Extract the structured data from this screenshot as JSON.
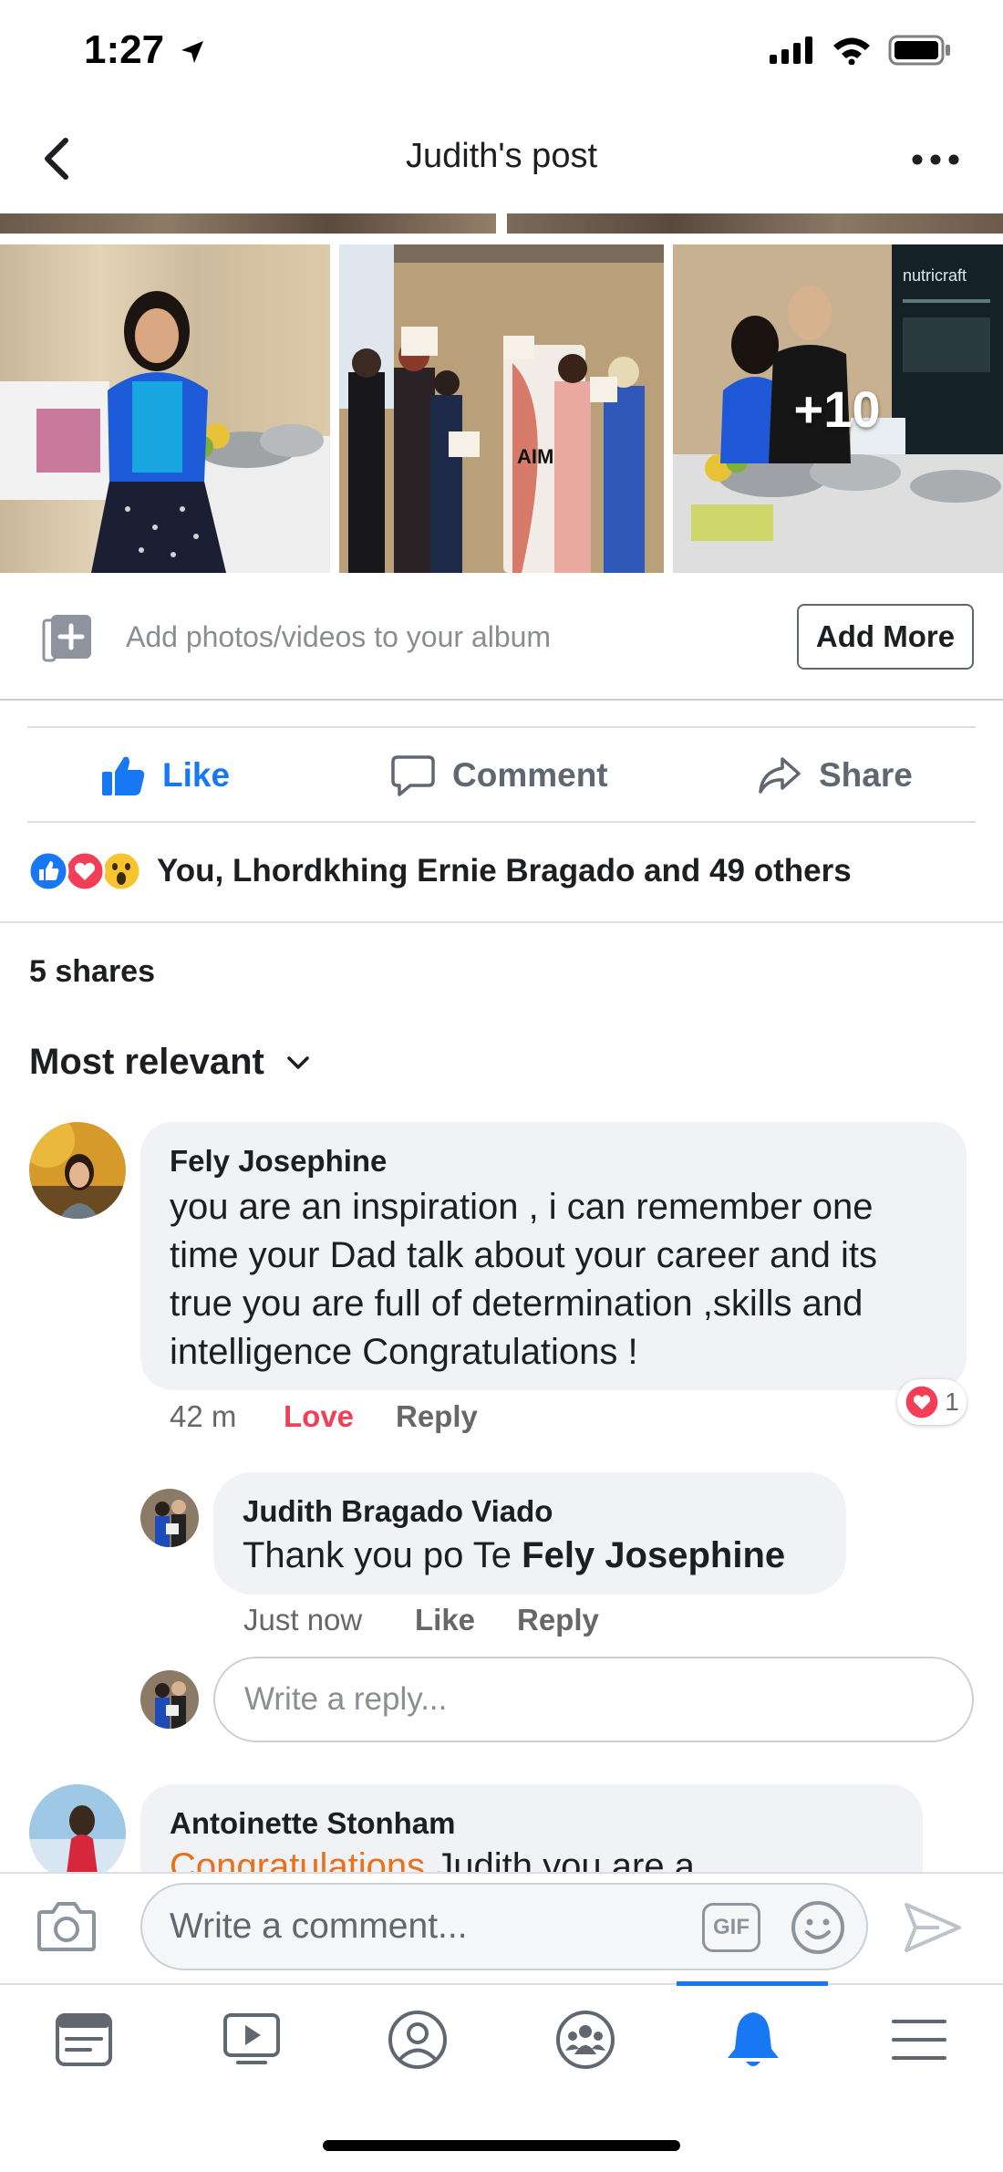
{
  "status_bar": {
    "time": "1:27"
  },
  "header": {
    "title": "Judith's post"
  },
  "photos": {
    "more_count": "+10",
    "booth_banner": "nutricraft",
    "pull_banner": "AIMM"
  },
  "album": {
    "placeholder": "Add photos/videos to your album",
    "add_more_label": "Add More"
  },
  "actions": {
    "like": "Like",
    "comment": "Comment",
    "share": "Share"
  },
  "reactions": {
    "summary": "You, Lhordkhing Ernie Bragado and 49 others"
  },
  "shares": "5 shares",
  "sort": {
    "label": "Most relevant"
  },
  "comments": [
    {
      "author": "Fely Josephine",
      "lines": [
        "you are an inspiration , i can remember one",
        "time your Dad talk about your career and its",
        "true you are full of determination ,skills  and",
        "intelligence Congratulations !"
      ],
      "time": "42 m",
      "reaction_label": "Love",
      "reply_label": "Reply",
      "reaction_count": "1"
    }
  ],
  "reply": {
    "author": "Judith Bragado Viado",
    "text_prefix": "Thank you po Te ",
    "mention": "Fely Josephine",
    "time": "Just now",
    "like_label": "Like",
    "reply_label": "Reply"
  },
  "reply_input": {
    "placeholder": "Write a reply..."
  },
  "next_comment": {
    "author": "Antoinette Stonham",
    "highlight": "Congratulations",
    "text": " Judith you are a"
  },
  "composer": {
    "placeholder": "Write a comment...",
    "gif_label": "GIF"
  },
  "colors": {
    "brand_blue": "#1877f2",
    "love_red": "#f33e58",
    "text_primary": "#1c1e21",
    "text_secondary": "#65676b",
    "bubble_bg": "#f0f2f5",
    "highlight_orange": "#e9711c"
  },
  "tabs": [
    {
      "icon": "news-feed-icon"
    },
    {
      "icon": "watch-icon"
    },
    {
      "icon": "profile-icon"
    },
    {
      "icon": "groups-icon"
    },
    {
      "icon": "notifications-icon",
      "active": true
    },
    {
      "icon": "menu-icon"
    }
  ]
}
